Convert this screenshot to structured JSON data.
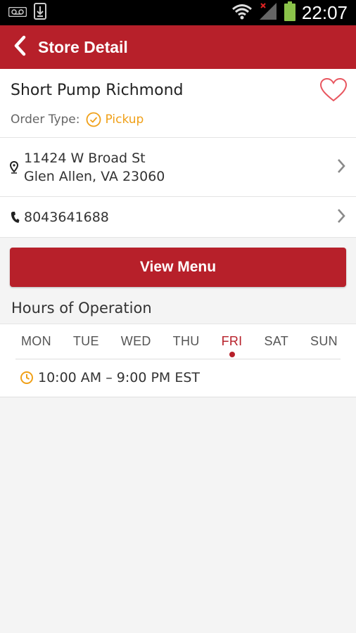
{
  "status": {
    "time": "22:07",
    "icons": [
      "voicemail-icon",
      "download-icon",
      "wifi-icon",
      "signal-icon",
      "battery-icon"
    ]
  },
  "header": {
    "title": "Store Detail"
  },
  "store": {
    "name": "Short Pump Richmond",
    "order_type_label": "Order Type:",
    "order_type_value": "Pickup",
    "address_line1": "11424 W Broad St",
    "address_line2": "Glen Allen, VA 23060",
    "phone": "8043641688"
  },
  "actions": {
    "view_menu": "View Menu"
  },
  "hours": {
    "title": "Hours of Operation",
    "days": [
      "MON",
      "TUE",
      "WED",
      "THU",
      "FRI",
      "SAT",
      "SUN"
    ],
    "selected_day": "FRI",
    "selected_hours": "10:00 AM – 9:00 PM EST"
  },
  "colors": {
    "brand": "#b7202a",
    "accent": "#f0a018"
  }
}
